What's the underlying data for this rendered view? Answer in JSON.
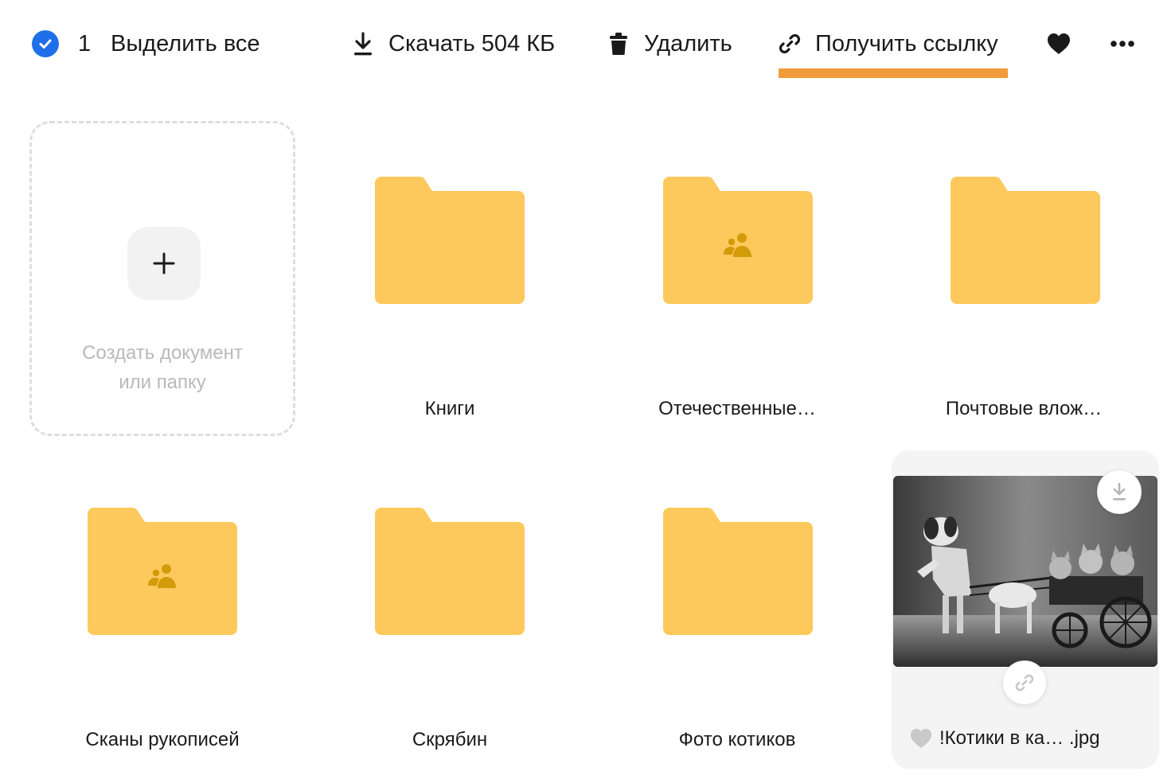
{
  "toolbar": {
    "selected_count": "1",
    "select_all_label": "Выделить все",
    "download_label": "Скачать 504 КБ",
    "delete_label": "Удалить",
    "get_link_label": "Получить ссылку",
    "icons": [
      "check-circle-icon",
      "download-icon",
      "trash-icon",
      "link-icon",
      "heart-icon",
      "more-icon"
    ]
  },
  "create": {
    "line1": "Создать документ",
    "line2": "или папку"
  },
  "items": [
    {
      "name": "Книги",
      "type": "folder",
      "shared": false
    },
    {
      "name": "Отечественные…",
      "type": "folder",
      "shared": true
    },
    {
      "name": "Почтовые влож…",
      "type": "folder",
      "shared": false
    },
    {
      "name": "Сканы рукописей",
      "type": "folder",
      "shared": true
    },
    {
      "name": "Скрябин",
      "type": "folder",
      "shared": false
    },
    {
      "name": "Фото котиков",
      "type": "folder",
      "shared": false
    },
    {
      "name": "!Котики в ка… .jpg",
      "type": "image",
      "selected": true
    }
  ],
  "colors": {
    "accent": "#f29b3a",
    "check": "#1f6fea",
    "folder": "#fdc95c",
    "folder_tab": "#fcc552",
    "shared_icon": "#d39a0a"
  }
}
